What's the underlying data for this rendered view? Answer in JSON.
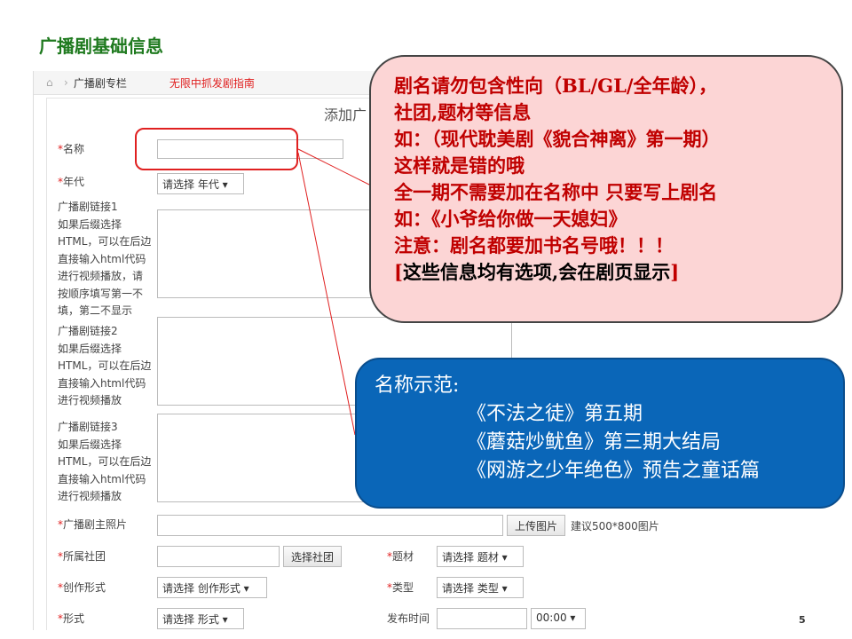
{
  "slide_title": "广播剧基础信息",
  "breadcrumb": {
    "home_icon": "home-icon",
    "item": "广播剧专栏",
    "guide_link": "无限中抓发剧指南"
  },
  "form": {
    "heading": "添加广",
    "name_label": "名称",
    "year_label": "年代",
    "year_select": "请选择 年代",
    "link1_label": [
      "广播剧链接1",
      "如果后缀选择",
      "HTML，可以在后边",
      "直接输入html代码",
      "进行视频播放，请",
      "按顺序填写第一不",
      "填，第二不显示"
    ],
    "link2_label": [
      "广播剧链接2",
      "如果后缀选择",
      "HTML，可以在后边",
      "直接输入html代码",
      "进行视频播放"
    ],
    "link3_label": [
      "广播剧链接3",
      "如果后缀选择",
      "HTML，可以在后边",
      "直接输入html代码",
      "进行视频播放"
    ],
    "photo_label": "广播剧主照片",
    "upload_button": "上传图片",
    "upload_hint": "建议500*800图片",
    "club_label": "所属社团",
    "club_button": "选择社团",
    "theme_label": "题材",
    "theme_select": "请选择 题材",
    "creation_label": "创作形式",
    "creation_select": "请选择 创作形式",
    "type_label": "类型",
    "type_select": "请选择 类型",
    "format_label": "形式",
    "format_select": "请选择 形式",
    "publish_label": "发布时间",
    "time_select": "00:00",
    "required_mark": "*"
  },
  "callout_red": {
    "lines": [
      "剧名请勿包含性向（BL/GL/全年龄），",
      "社团,题材等信息",
      "如：（现代耽美剧《貌合神离》第一期）",
      "这样就是错的哦",
      "全一期不需要加在名称中 只要写上剧名",
      "如：《小爷给你做一天媳妇》",
      "注意：剧名都要加书名号哦！！！"
    ],
    "bracket_open": "[",
    "bracket_text": "这些信息均有选项,会在剧页显示",
    "bracket_close": "]"
  },
  "callout_blue": {
    "title": "名称示范:",
    "examples": [
      "《不法之徒》第五期",
      "《蘑菇炒鱿鱼》第三期大结局",
      "《网游之少年绝色》预告之童话篇"
    ]
  },
  "page_number": "5",
  "colors": {
    "title_green": "#1f7a1f",
    "required_red": "#e02020",
    "callout_pink": "#fcd5d5",
    "callout_blue": "#0a66b8"
  }
}
